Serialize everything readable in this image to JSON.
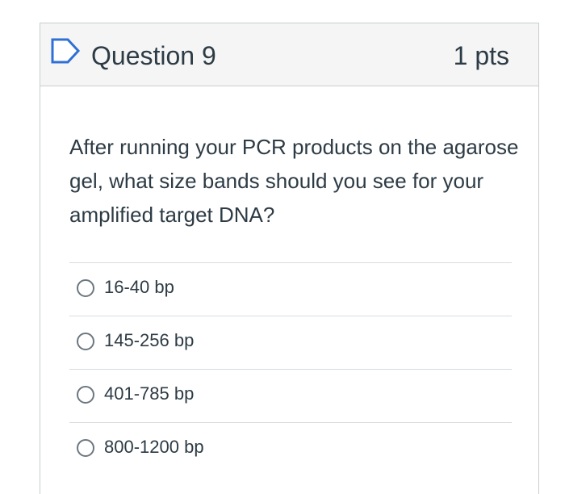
{
  "question": {
    "title": "Question 9",
    "points": "1 pts",
    "flag_icon": "flag-icon",
    "text": "After running your PCR products on the agarose gel, what size bands should you see for your amplified target DNA?",
    "answers": [
      {
        "label": "16-40 bp",
        "selected": false
      },
      {
        "label": "145-256 bp",
        "selected": false
      },
      {
        "label": "401-785 bp",
        "selected": false
      },
      {
        "label": "800-1200 bp",
        "selected": false
      }
    ]
  },
  "colors": {
    "text": "#2d3b45",
    "header_bg": "#f5f5f5",
    "border": "#c7cdd1",
    "flag_blue": "#2f6fd6"
  }
}
